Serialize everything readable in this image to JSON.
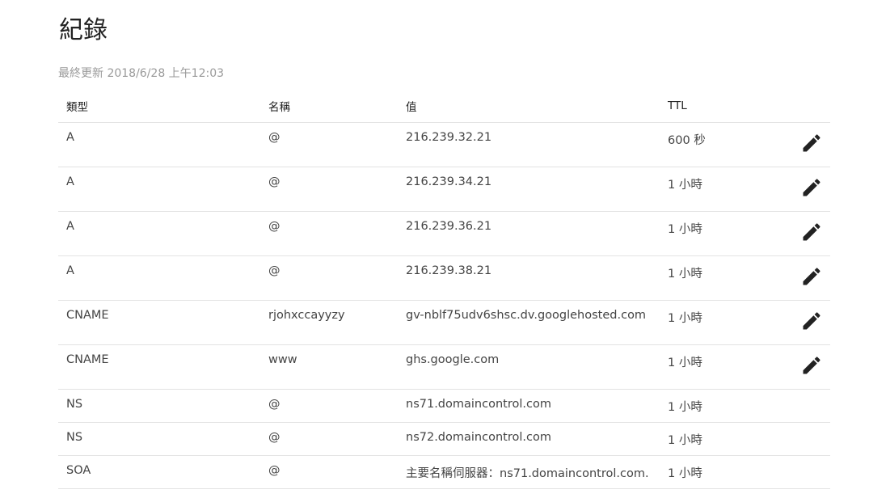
{
  "page": {
    "title": "紀錄",
    "last_updated": "最終更新 2018/6/28 上午12:03"
  },
  "table": {
    "headers": {
      "type": "類型",
      "name": "名稱",
      "value": "值",
      "ttl": "TTL"
    },
    "rows": [
      {
        "type": "A",
        "name": "@",
        "value": "216.239.32.21",
        "ttl": "600 秒",
        "editable": true
      },
      {
        "type": "A",
        "name": "@",
        "value": "216.239.34.21",
        "ttl": "1 小時",
        "editable": true
      },
      {
        "type": "A",
        "name": "@",
        "value": "216.239.36.21",
        "ttl": "1 小時",
        "editable": true
      },
      {
        "type": "A",
        "name": "@",
        "value": "216.239.38.21",
        "ttl": "1 小時",
        "editable": true
      },
      {
        "type": "CNAME",
        "name": "rjohxccayyzy",
        "value": "gv-nblf75udv6shsc.dv.googlehosted.com",
        "ttl": "1 小時",
        "editable": true
      },
      {
        "type": "CNAME",
        "name": "www",
        "value": "ghs.google.com",
        "ttl": "1 小時",
        "editable": true
      },
      {
        "type": "NS",
        "name": "@",
        "value": "ns71.domaincontrol.com",
        "ttl": "1 小時",
        "editable": false
      },
      {
        "type": "NS",
        "name": "@",
        "value": "ns72.domaincontrol.com",
        "ttl": "1 小時",
        "editable": false
      },
      {
        "type": "SOA",
        "name": "@",
        "value": "主要名稱伺服器：ns71.domaincontrol.com.",
        "ttl": "1 小時",
        "editable": false
      }
    ]
  },
  "icons": {
    "edit": "pencil-icon"
  },
  "colors": {
    "icon": "#222222",
    "muted_text": "#9a9a9a",
    "divider": "#e3e3e3"
  }
}
